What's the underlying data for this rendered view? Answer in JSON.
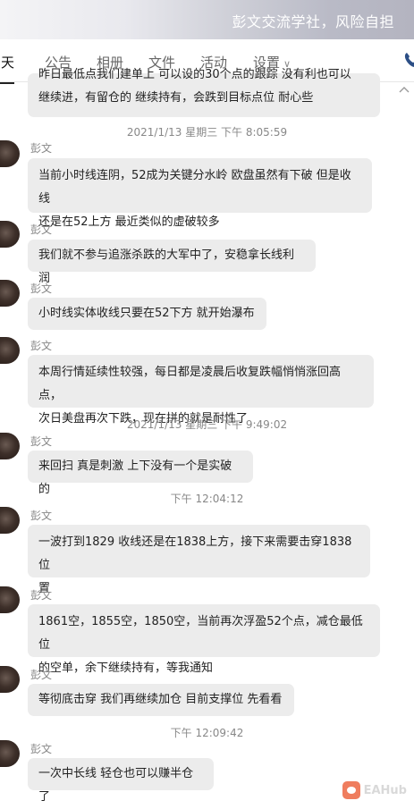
{
  "window": {
    "title": "彭文交流学社，风险自担"
  },
  "tabs": [
    {
      "label": "聊天",
      "visible": "聊天"
    },
    {
      "label": "公告"
    },
    {
      "label": "相册"
    },
    {
      "label": "文件"
    },
    {
      "label": "活动"
    },
    {
      "label": "设置"
    }
  ],
  "chat": {
    "partial_top": [
      "昨日最低点我们建单上 可以设的30个点的跟踪 没有利也可以",
      "继续进，有留仓的 继续持有，会跌到目标点位 耐心些"
    ],
    "timestamps": {
      "t1": "2021/1/13 星期三 下午 8:05:59",
      "t2": "2021/1/13 星期三 下午 9:49:02",
      "t3": "下午 12:04:12",
      "t4": "下午 12:09:42"
    },
    "messages": [
      {
        "sender": "彭文",
        "lines": [
          "当前小时线连阴，52成为关键分水岭 欧盘虽然有下破 但是收线",
          "还是在52上方 最近类似的虚破较多"
        ]
      },
      {
        "sender": "彭文",
        "lines": [
          "我们就不参与追涨杀跌的大军中了，安稳拿长线利润"
        ]
      },
      {
        "sender": "彭文",
        "lines": [
          "小时线实体收线只要在52下方  就开始瀑布"
        ]
      },
      {
        "sender": "彭文",
        "lines": [
          "本周行情延续性较强，每日都是凌晨后收复跌幅悄悄涨回高点，",
          "次日美盘再次下跌，现在拼的就是耐性了"
        ]
      },
      {
        "sender": "彭文",
        "lines": [
          "来回扫 真是刺激 上下没有一个是实破的"
        ]
      },
      {
        "sender": "彭文",
        "lines": [
          "一波打到1829 收线还是在1838上方，接下来需要击穿1838位",
          "置"
        ]
      },
      {
        "sender": "彭文",
        "lines": [
          "1861空，1855空，1850空，当前再次浮盈52个点，减仓最低位",
          "的空单，余下继续持有，等我通知"
        ]
      },
      {
        "sender": "彭文",
        "lines": [
          "等彻底击穿 我们再继续加仓  目前支撑位 先看看"
        ]
      },
      {
        "sender": "彭文",
        "lines": [
          "一次中长线 轻仓也可以赚半仓了"
        ]
      }
    ]
  },
  "watermark": {
    "text": "EAHub"
  },
  "colors": {
    "bubble": "#ececec",
    "accent_logo": "#ef7d5e"
  }
}
